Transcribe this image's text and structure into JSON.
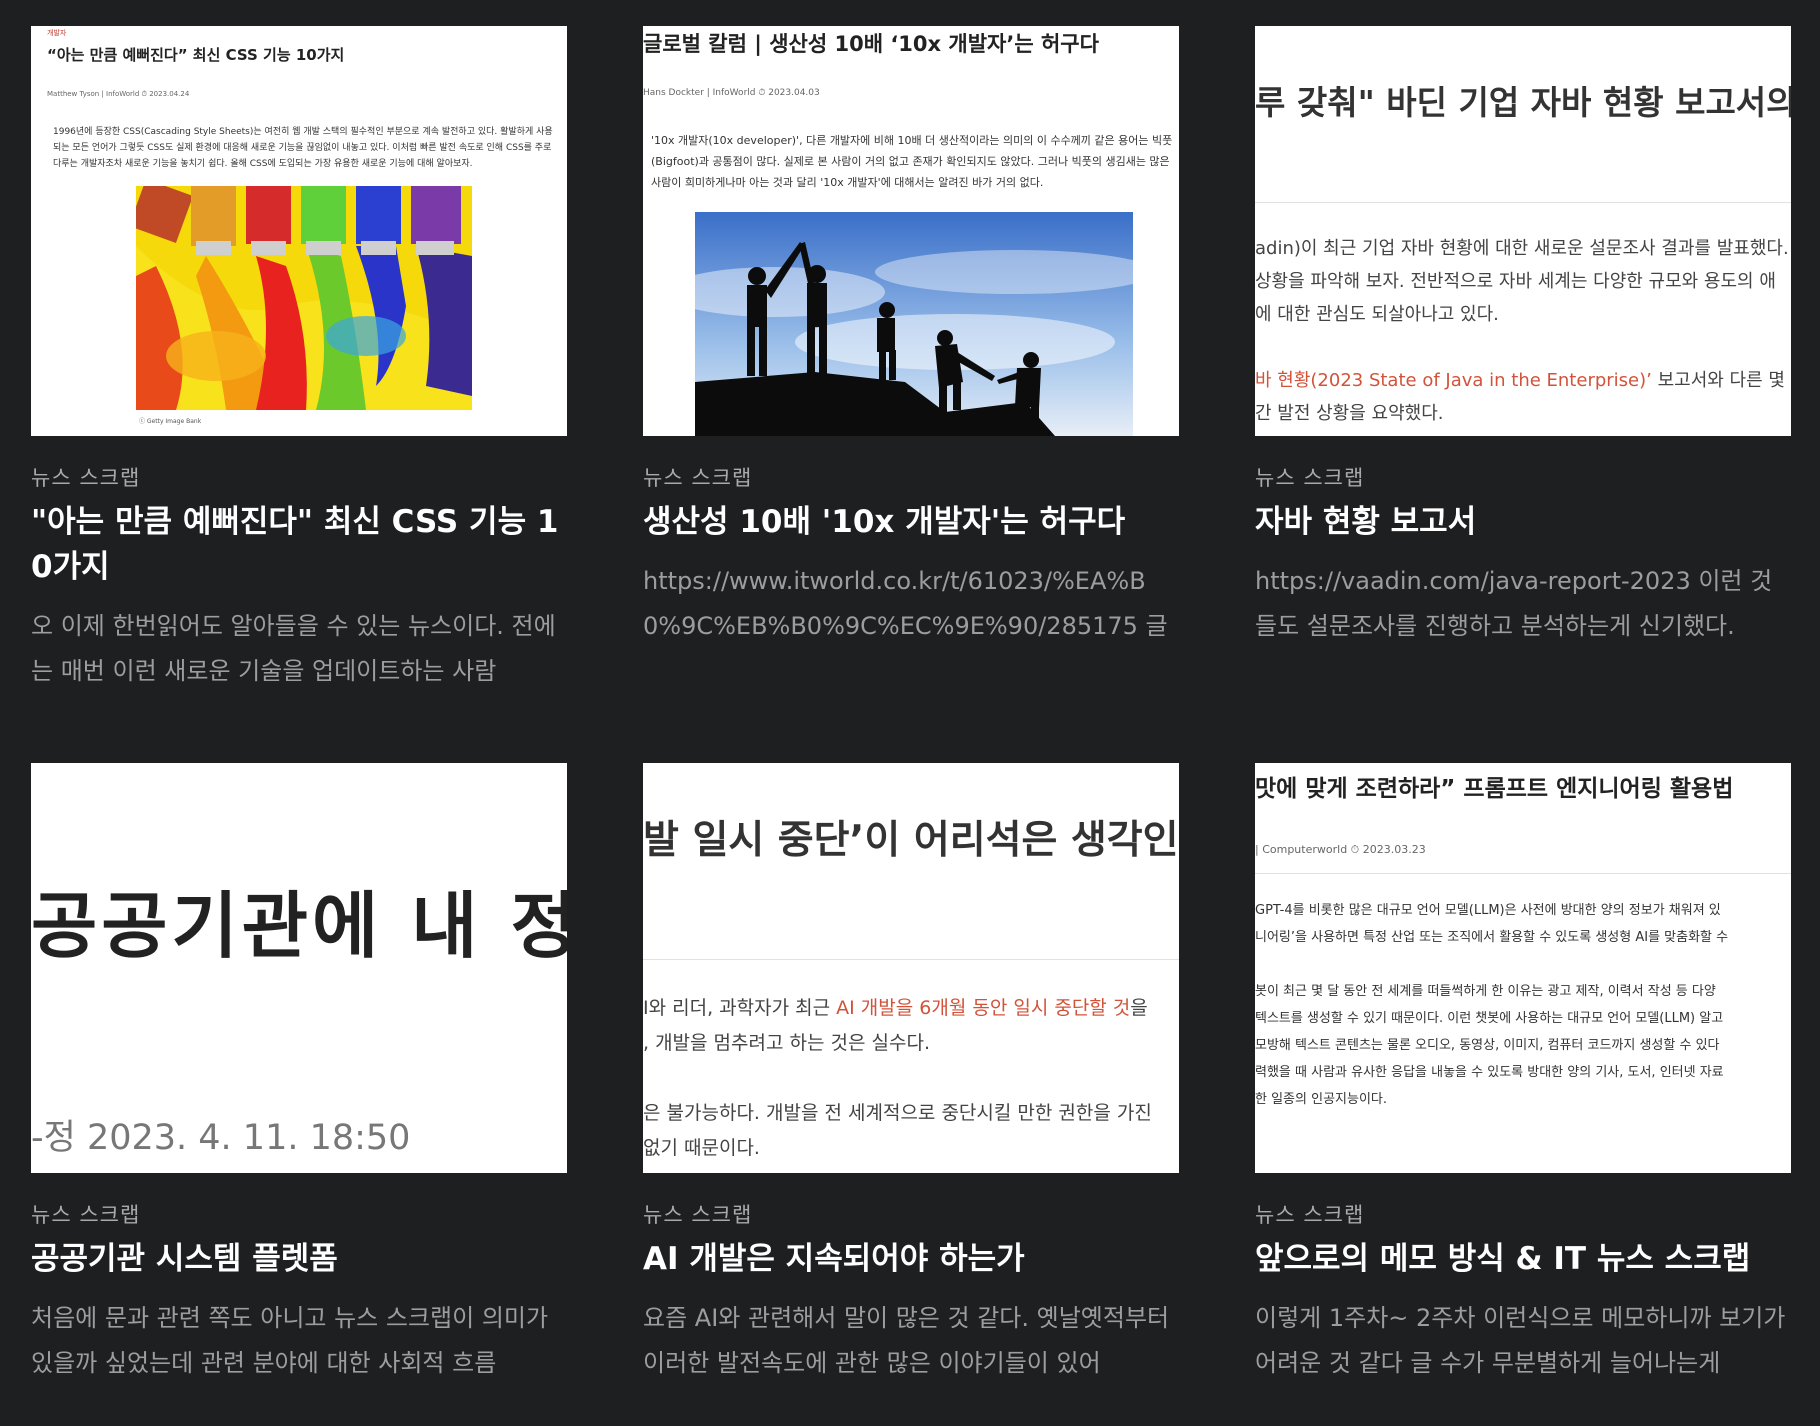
{
  "cards": [
    {
      "category": "뉴스 스크랩",
      "title": "\"아는 만큼 예뻐진다\" 최신 CSS 기능 10가지",
      "excerpt": "오 이제 한번읽어도 알아들을 수 있는 뉴스이다. 전에는 매번 이런 새로운 기술을 업데이트하는 사람",
      "thumb": {
        "tag": "개발자",
        "title": "“아는 만큼 예뻐진다” 최신 CSS 기능 10가지",
        "meta": "Matthew Tyson | InfoWorld    ⏱ 2023.04.24",
        "body": "1996년에 등장한 CSS(Cascading Style Sheets)는 여전히 웹 개발 스택의 필수적인 부분으로 계속 발전하고 있다. 활발하게 사용되는 모든 언어가 그렇듯 CSS도 실제 환경에 대응해 새로운 기능을 끊임없이 내놓고 있다. 이처럼 빠른 발전 속도로 인해 CSS를 주로 다루는 개발자조차 새로운 기능을 놓치기 쉽다. 올해 CSS에 도입되는 가장 유용한 새로운 기능에 대해 알아보자.",
        "credit": "ⓒ Getty Image Bank"
      }
    },
    {
      "category": "뉴스 스크랩",
      "title": "생산성 10배 '10x 개발자'는 허구다",
      "excerpt": "https://www.itworld.co.kr/t/61023/%EA%B0%9C%EB%B0%9C%EC%9E%90/285175 글",
      "thumb": {
        "title": "글로벌 칼럼 | 생산성 10배 ‘10x 개발자’는 허구다",
        "meta": "Hans Dockter | InfoWorld    ⏱ 2023.04.03",
        "body": "'10x 개발자(10x developer)', 다른 개발자에 비해 10배 더 생산적이라는 의미의 이 수수께끼 같은 용어는 빅풋(Bigfoot)과 공통점이 많다. 실제로 본 사람이 거의 없고 존재가 확인되지도 않았다. 그러나 빅풋의 생김새는 많은 사람이 희미하게나마 아는 것과 달리 '10x 개발자'에 대해서는 알려진 바가 거의 없다."
      }
    },
    {
      "category": "뉴스 스크랩",
      "title": "자바 현황 보고서",
      "excerpt": "https://vaadin.com/java-report-2023 이런 것들도 설문조사를 진행하고 분석하는게 신기했다.",
      "thumb": {
        "title": "루 갖춰\" 바딘 기업 자바 현황 보고서의 ?",
        "line1": "adin)이 최근 기업 자바 현황에 대한 새로운 설문조사 결과를 발표했다.",
        "line2": "상황을 파악해 보자.  전반적으로 자바 세계는 다양한 규모와 용도의 애",
        "line3": "에 대한 관심도 되살아나고 있다.",
        "line4_red": "바 현황(2023 State of Java in the Enterprise)’",
        "line4_rest": " 보고서와 다른 몇 가",
        "line5": "간 발전 상황을 요약했다."
      }
    },
    {
      "category": "뉴스 스크랩",
      "title": "공공기관 시스템 플렛폼",
      "excerpt": "처음에 문과 관련 쪽도 아니고 뉴스 스크랩이 의미가 있을까 싶었는데 관련 분야에 대한 사회적 흐름",
      "thumb": {
        "title": "공공기관에 내 정",
        "date": "-정 2023. 4. 11. 18:50"
      }
    },
    {
      "category": "뉴스 스크랩",
      "title": "AI 개발은 지속되어야 하는가",
      "excerpt": "요즘 AI와 관련해서 말이 많은 것 같다. 옛날옛적부터 이러한 발전속도에 관한 많은 이야기들이 있어",
      "thumb": {
        "title": "발 일시 중단’이 어리석은 생각인 이유",
        "line1_pre": "I와 리더, 과학자가 최근 ",
        "line1_red": "AI 개발을 6개월 동안 일시 중단할 것",
        "line1_post": "을 ",
        "line2": ", 개발을 멈추려고 하는 것은 실수다.",
        "line3": "은 불가능하다. 개발을 전 세계적으로 중단시킬 만한 권한을 가진",
        "line4": " 없기 때문이다."
      }
    },
    {
      "category": "뉴스 스크랩",
      "title": "앞으로의 메모 방식 & IT 뉴스 스크랩",
      "excerpt": "이렇게 1주차~ 2주차 이런식으로 메모하니까 보기가 어려운 것 같다 글 수가 무분별하게 늘어나는게",
      "thumb": {
        "title": "맛에 맞게 조련하라” 프롬프트 엔지니어링 활용법",
        "meta": "| Computerworld    ⏱ 2023.03.23",
        "l1": "GPT-4를 비롯한 많은 대규모 언어 모델(LLM)은 사전에 방대한 양의 정보가 채워져 있",
        "l2": "니어링’을 사용하면 특정 산업 또는 조직에서 활용할 수 있도록 생성형 AI를 맞춤화할 수",
        "l3": "봇이 최근 몇 달 동안 전 세계를 떠들썩하게 한 이유는 광고 제작, 이력서 작성 등 다양",
        "l4": "텍스트를 생성할 수 있기 때문이다. 이런 챗봇에 사용하는 대규모 언어 모델(LLM) 알고",
        "l5": "모방해 텍스트 콘텐츠는 물론 오디오, 동영상, 이미지, 컴퓨터 코드까지 생성할 수 있다",
        "l6": "력했을 때 사람과 유사한 응답을 내놓을 수 있도록 방대한 양의 기사, 도서, 인터넷 자료",
        "l7": "한 일종의 인공지능이다."
      }
    }
  ]
}
